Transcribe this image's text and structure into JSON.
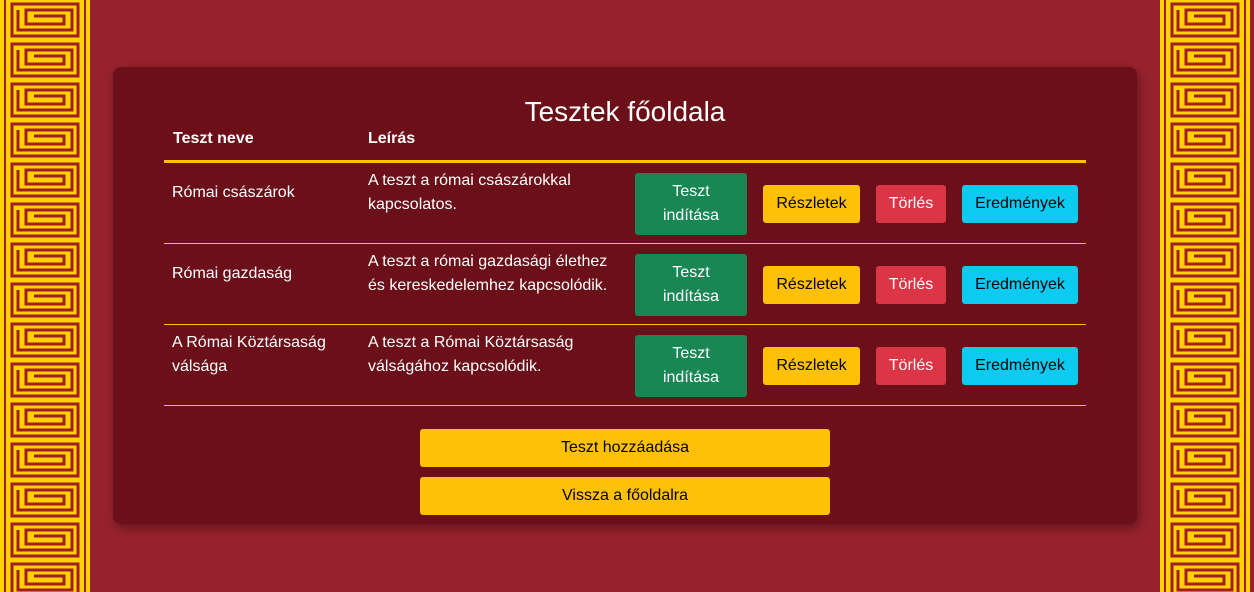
{
  "page": {
    "title": "Tesztek főoldala"
  },
  "table": {
    "headers": {
      "name": "Teszt neve",
      "description": "Leírás"
    },
    "rows": [
      {
        "name": "Római császárok",
        "description": "A teszt a római császárokkal kapcsolatos."
      },
      {
        "name": "Római gazdaság",
        "description": "A teszt a római gazdasági élethez és kereskedelemhez kapcsolódik."
      },
      {
        "name": "A Római Köztársaság válsága",
        "description": "A teszt a Római Köztársaság válságához kapcsolódik."
      }
    ]
  },
  "buttons": {
    "start": "Teszt indítása",
    "details": "Részletek",
    "delete": "Törlés",
    "results": "Eredmények",
    "add_test": "Teszt hozzáadása",
    "back_home": "Vissza a főoldalra"
  },
  "colors": {
    "background": "#96222d",
    "panel": "#6b0f18",
    "accent": "#ffc107",
    "start": "#198754",
    "delete": "#dc3545",
    "results": "#0dcaf0",
    "border_gold": "#ffd200"
  },
  "decor": {
    "border_pattern": "greek-key-meander-border"
  }
}
